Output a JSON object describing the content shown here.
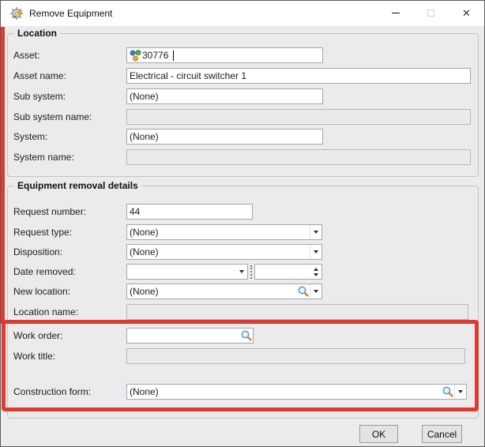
{
  "titlebar": {
    "title": "Remove Equipment"
  },
  "icons": {
    "close_glyph": "✕"
  },
  "location": {
    "title": "Location",
    "asset_label": "Asset:",
    "asset_value": "30776",
    "asset_name_label": "Asset name:",
    "asset_name_value": "Electrical - circuit switcher 1",
    "sub_system_label": "Sub system:",
    "sub_system_value": "(None)",
    "sub_system_name_label": "Sub system name:",
    "sub_system_name_value": "",
    "system_label": "System:",
    "system_value": "(None)",
    "system_name_label": "System name:",
    "system_name_value": ""
  },
  "details": {
    "title": "Equipment removal details",
    "request_number_label": "Request number:",
    "request_number_value": "44",
    "request_type_label": "Request type:",
    "request_type_value": "(None)",
    "disposition_label": "Disposition:",
    "disposition_value": "(None)",
    "date_removed_label": "Date removed:",
    "date_value": "",
    "time_value": "",
    "new_location_label": "New location:",
    "new_location_value": "(None)",
    "location_name_label": "Location name:",
    "location_name_value": "",
    "work_order_label": "Work order:",
    "work_order_value": "",
    "work_title_label": "Work title:",
    "work_title_value": "",
    "construction_form_label": "Construction form:",
    "construction_form_value": "(None)"
  },
  "buttons": {
    "ok": "OK",
    "cancel": "Cancel"
  },
  "colors": {
    "highlight_red": "#dd3a31",
    "titlebar_bg": "#ffffff",
    "dialog_bg": "#ebebeb"
  }
}
